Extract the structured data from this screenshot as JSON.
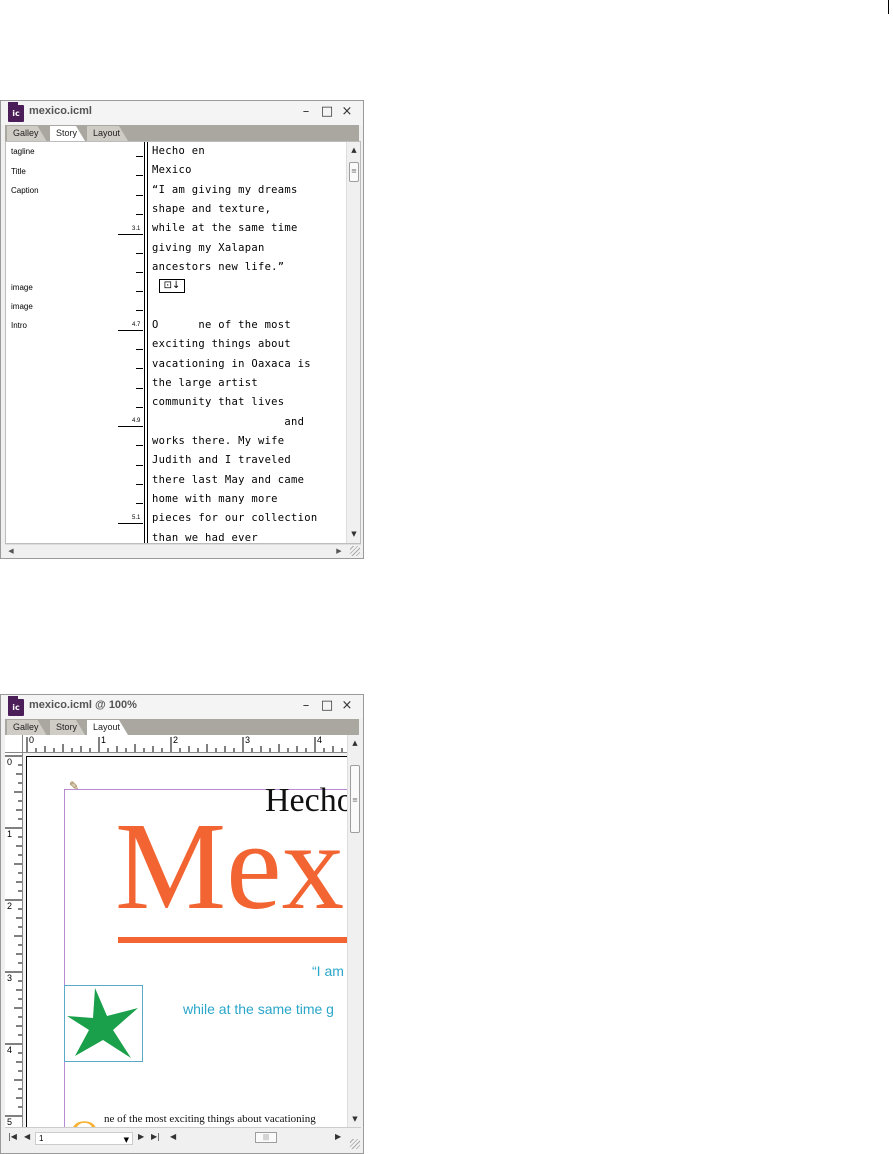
{
  "story_window": {
    "title": "mexico.icml",
    "tabs": [
      "Galley",
      "Story",
      "Layout"
    ],
    "active_tab": "Story",
    "style_labels": [
      "tagline",
      "Title",
      "Caption",
      "image",
      "image",
      "Intro"
    ],
    "depth_markers": [
      "3.1",
      "4.7",
      "4.9",
      "5.1"
    ],
    "text_lines": [
      "Hecho en",
      "Mexico",
      "“I am giving my dreams",
      "shape and texture,",
      "while at the same time",
      "giving my Xalapan",
      "ancestors new life.”",
      "",
      "O      ne of the most",
      "exciting things about",
      "vacationing in Oaxaca is",
      "the large artist",
      "community that lives",
      "                    and",
      "works there. My wife",
      "Judith and I traveled",
      "there last May and came",
      "home with many more",
      "pieces for our collection",
      "than we had ever"
    ]
  },
  "layout_window": {
    "title": "mexico.icml @ 100%",
    "tabs": [
      "Galley",
      "Story",
      "Layout"
    ],
    "active_tab": "Layout",
    "ruler_h": [
      "0",
      "1",
      "2",
      "3",
      "4"
    ],
    "ruler_v": [
      "0",
      "1",
      "2",
      "3",
      "4",
      "5"
    ],
    "page": {
      "hecho": "Hecho",
      "mexico": "Mex",
      "quote1": "“I am",
      "quote2": "while at the same time g",
      "body": "ne of the most exciting things about vacationing",
      "dropcap": "O"
    },
    "page_number": "1"
  },
  "colors": {
    "accent_orange": "#f26533",
    "accent_teal": "#2aa6c9",
    "star_green": "#1aa04a",
    "frame_purple": "#b88ad1",
    "app_icon": "#4b1d59"
  },
  "icons": [
    "incopy-app-icon",
    "minimize-icon",
    "maximize-icon",
    "close-icon",
    "anchored-object-icon",
    "pencil-icon",
    "star-image"
  ]
}
